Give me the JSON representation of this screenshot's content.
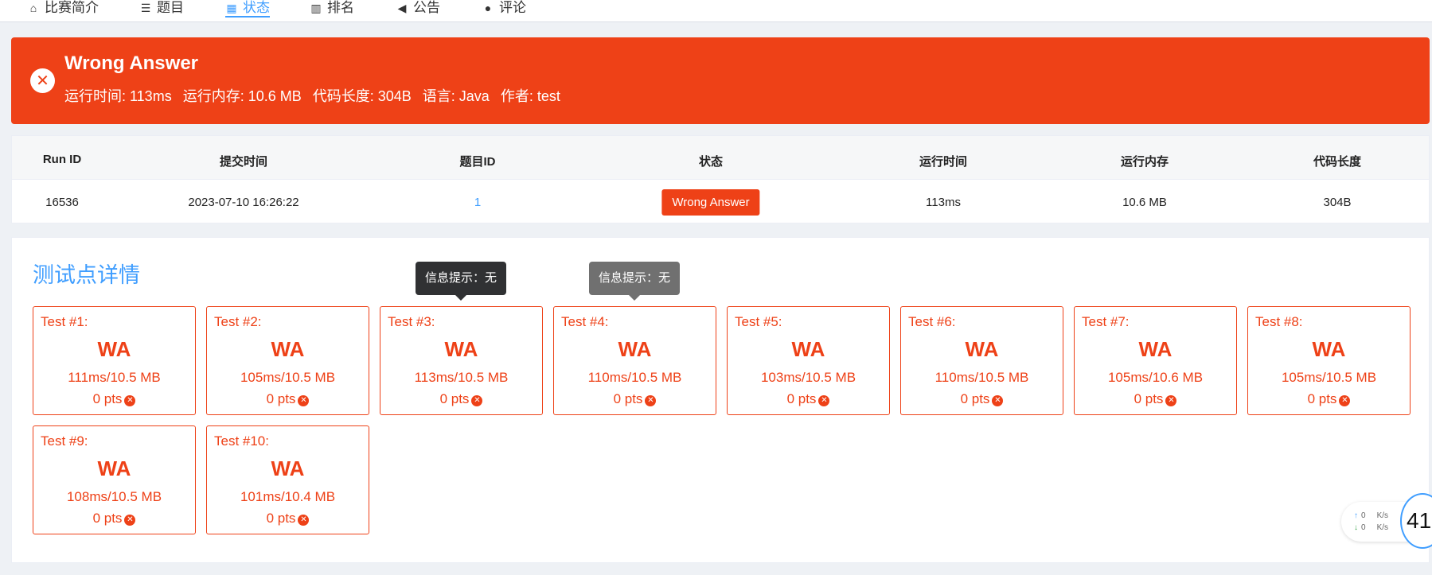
{
  "nav": {
    "items": [
      {
        "label": "比赛简介",
        "icon": "home-icon"
      },
      {
        "label": "题目",
        "icon": "list-icon"
      },
      {
        "label": "状态",
        "icon": "grid-icon",
        "active": true
      },
      {
        "label": "排名",
        "icon": "bar-chart-icon"
      },
      {
        "label": "公告",
        "icon": "megaphone-icon"
      },
      {
        "label": "评论",
        "icon": "comment-icon"
      }
    ]
  },
  "banner": {
    "title": "Wrong Answer",
    "color": "#ee4117",
    "icon": "close-circle-icon",
    "run_time": "运行时间: 113ms",
    "memory": "运行内存: 10.6 MB",
    "code_length": "代码长度: 304B",
    "language": "语言: Java",
    "author": "作者: test"
  },
  "run_table": {
    "headers": [
      "Run ID",
      "提交时间",
      "题目ID",
      "状态",
      "运行时间",
      "运行内存",
      "代码长度"
    ],
    "row": {
      "run_id": "16536",
      "submit_time": "2023-07-10 16:26:22",
      "problem_id": "1",
      "status": "Wrong Answer",
      "run_time": "113ms",
      "memory": "10.6 MB",
      "code_length": "304B"
    }
  },
  "cases": {
    "title": "测试点详情",
    "tooltip_text": "信息提示：无",
    "items": [
      {
        "label": "Test #1:",
        "result": "WA",
        "stats": "111ms/10.5 MB",
        "pts": "0 pts"
      },
      {
        "label": "Test #2:",
        "result": "WA",
        "stats": "105ms/10.5 MB",
        "pts": "0 pts"
      },
      {
        "label": "Test #3:",
        "result": "WA",
        "stats": "113ms/10.5 MB",
        "pts": "0 pts"
      },
      {
        "label": "Test #4:",
        "result": "WA",
        "stats": "110ms/10.5 MB",
        "pts": "0 pts"
      },
      {
        "label": "Test #5:",
        "result": "WA",
        "stats": "103ms/10.5 MB",
        "pts": "0 pts"
      },
      {
        "label": "Test #6:",
        "result": "WA",
        "stats": "110ms/10.5 MB",
        "pts": "0 pts"
      },
      {
        "label": "Test #7:",
        "result": "WA",
        "stats": "105ms/10.6 MB",
        "pts": "0 pts"
      },
      {
        "label": "Test #8:",
        "result": "WA",
        "stats": "105ms/10.5 MB",
        "pts": "0 pts"
      },
      {
        "label": "Test #9:",
        "result": "WA",
        "stats": "108ms/10.5 MB",
        "pts": "0 pts"
      },
      {
        "label": "Test #10:",
        "result": "WA",
        "stats": "101ms/10.4 MB",
        "pts": "0 pts"
      }
    ]
  },
  "speed_widget": {
    "up_value": "0",
    "up_unit": "K/s",
    "down_value": "0",
    "down_unit": "K/s",
    "ring_value": "41"
  }
}
